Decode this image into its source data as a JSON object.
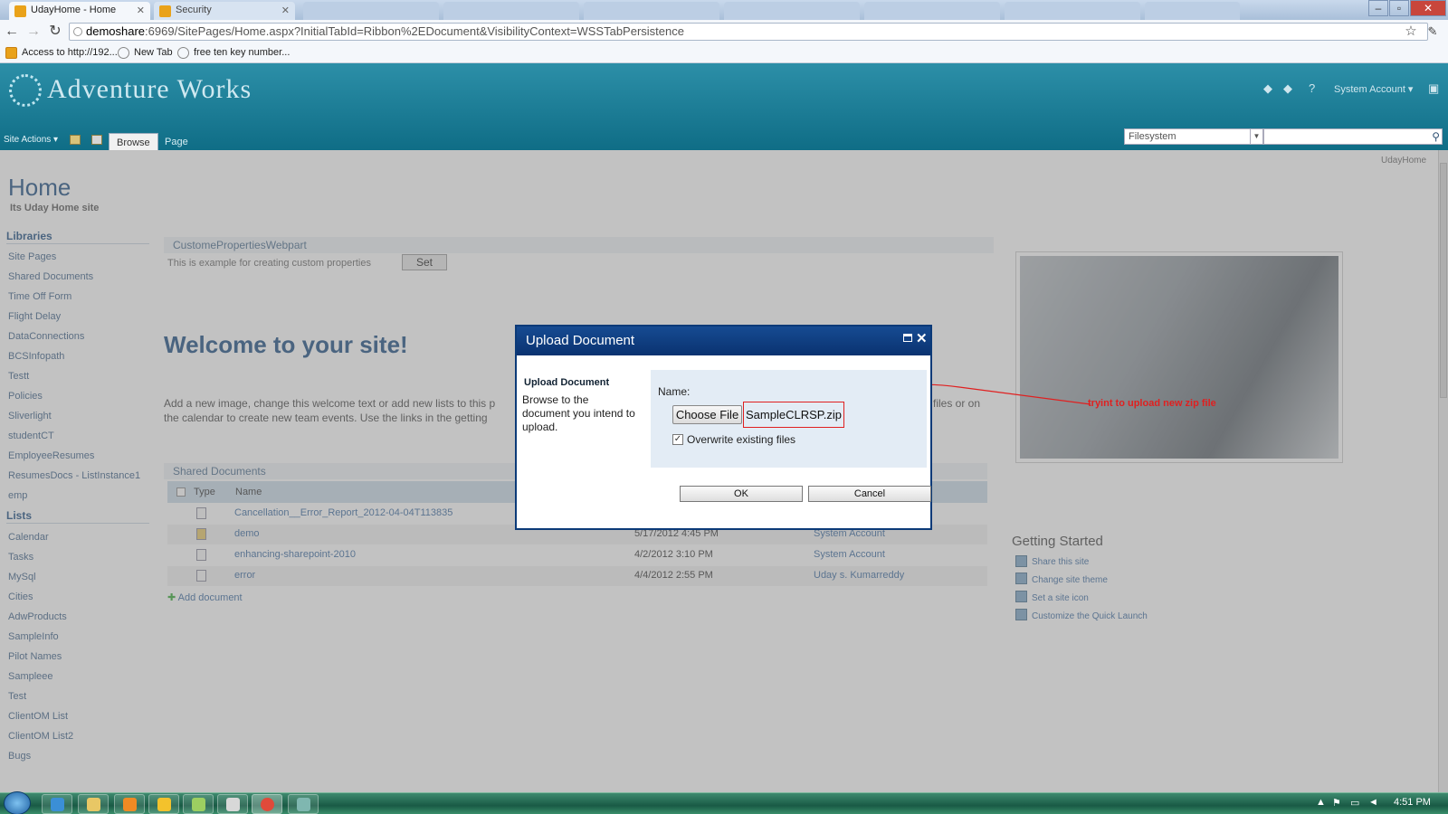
{
  "browser": {
    "tabs": [
      {
        "title": "UdayHome - Home"
      },
      {
        "title": "Security"
      }
    ],
    "address": {
      "host": "demoshare",
      "rest": ":6969/SitePages/Home.aspx?InitialTabId=Ribbon%2EDocument&VisibilityContext=WSSTabPersistence"
    },
    "bookmarks": [
      "Access to http://192...",
      "New Tab",
      "free ten key number..."
    ]
  },
  "site": {
    "title": "Adventure Works",
    "user": "System Account",
    "site_actions": "Site Actions",
    "ribbon_tabs": [
      "Browse",
      "Page"
    ],
    "search_scope": "Filesystem",
    "breadcrumb_right": "UdayHome"
  },
  "page": {
    "title": "Home",
    "description": "Its Uday Home site",
    "libraries_head": "Libraries",
    "libraries": [
      "Site Pages",
      "Shared Documents",
      "Time Off Form",
      "Flight Delay",
      "DataConnections",
      "BCSInfopath",
      "Testt",
      "Policies",
      "Sliverlight",
      "studentCT",
      "EmployeeResumes",
      "ResumesDocs - ListInstance1",
      "emp"
    ],
    "lists_head": "Lists",
    "lists": [
      "Calendar",
      "Tasks",
      "MySql",
      "Cities",
      "AdwProducts",
      "SampleInfo",
      "Pilot Names",
      "Sampleee",
      "Test",
      "ClientOM List",
      "ClientOM List2",
      "Bugs"
    ],
    "webpart_title": "CustomePropertiesWebpart",
    "webpart_text": "This is example for creating custom properties",
    "set_label": "Set",
    "welcome": "Welcome to your site!",
    "welcome_text_left": "Add a new image, change this welcome text or add new lists to this p",
    "welcome_text_left2": "the calendar to create new team events. Use the links in the getting",
    "welcome_text_right": "files or on",
    "shared_docs_title": "Shared Documents",
    "grid_cols": [
      "Type",
      "Name"
    ],
    "docs": [
      {
        "name": "Cancellation__Error_Report_2012-04-04T113835",
        "modified": "",
        "by": ""
      },
      {
        "name": "demo",
        "modified": "5/17/2012 4:45 PM",
        "by": "System Account"
      },
      {
        "name": "enhancing-sharepoint-2010",
        "modified": "4/2/2012 3:10 PM",
        "by": "System Account"
      },
      {
        "name": "error",
        "modified": "4/4/2012 2:55 PM",
        "by": "Uday s. Kumarreddy"
      }
    ],
    "add_document": "Add document",
    "getting_started": "Getting Started",
    "gs_items": [
      "Share this site",
      "Change site theme",
      "Set a site icon",
      "Customize the Quick Launch"
    ]
  },
  "dialog": {
    "title": "Upload Document",
    "left_head": "Upload Document",
    "left_text": "Browse to the document you intend to upload.",
    "name_label": "Name:",
    "choose_file": "Choose File",
    "file_name": "SampleCLRSP.zip",
    "overwrite_label": "Overwrite existing files",
    "overwrite_checked": true,
    "ok": "OK",
    "cancel": "Cancel"
  },
  "annotation": {
    "text": "tryint to upload new zip file",
    "color": "#e02020"
  },
  "taskbar": {
    "time": "4:51 PM"
  }
}
